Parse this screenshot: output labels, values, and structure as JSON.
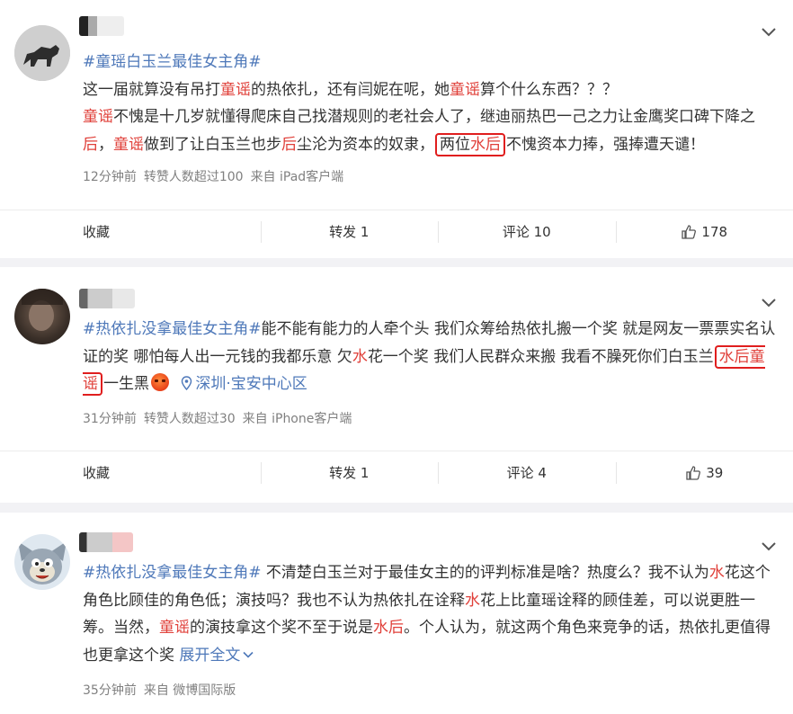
{
  "posts": [
    {
      "tag": "#童瑶白玉兰最佳女主角#",
      "text": {
        "l1a": "这一届就算没有吊打",
        "l1b": "童谣",
        "l1c": "的热依扎，还有闫妮在呢，她",
        "l1d": "童谣",
        "l1e": "算个什么东西？？？",
        "l2a": "童谣",
        "l2b": "不愧是十几岁就懂得爬床自己找潜规则的老社会人了，继迪丽热巴一己之力让金鹰奖口碑下降之",
        "l2c": "后",
        "l2d": "，",
        "l2e": "童谣",
        "l2f": "做到了让白玉兰也步",
        "l2g": "后",
        "l2h": "尘沦为资本的奴隶，",
        "box_a": "两位",
        "box_b": "水后",
        "l2i": "不愧资本力捧，强捧遭天谴！"
      },
      "meta": {
        "time": "12分钟前",
        "reposts": "转赞人数超过100",
        "source": "来自 iPad客户端"
      },
      "actions": {
        "collect": "收藏",
        "repost": "转发 1",
        "comment": "评论 10",
        "like": "178"
      }
    },
    {
      "tag": "#热依扎没拿最佳女主角#",
      "text": {
        "a": "能不能有能力的人牵个头 我们众筹给热依扎搬一个奖 就是网友一票票实名认证的奖 哪怕每人出一元钱的我都乐意 欠",
        "b": "水",
        "c": "花一个奖 我们人民群众来搬 我看不臊死你们白玉兰",
        "box": "水后童谣",
        "d": "一生黑",
        "loc": "深圳·宝安中心区"
      },
      "meta": {
        "time": "31分钟前",
        "reposts": "转赞人数超过30",
        "source": "来自 iPhone客户端"
      },
      "actions": {
        "collect": "收藏",
        "repost": "转发 1",
        "comment": "评论 4",
        "like": "39"
      }
    },
    {
      "tag": "#热依扎没拿最佳女主角#",
      "text": {
        "a": " 不清楚白玉兰对于最佳女主的的评判标准是啥？热度么？我不认为",
        "b": "水",
        "c": "花这个角色比顾佳的角色低；演技吗？我也不认为热依扎在诠释",
        "d": "水",
        "e": "花上比童瑶诠释的顾佳差，可以说更胜一筹。当然，",
        "f": "童谣",
        "g": "的演技拿这个奖不至于说是",
        "h": "水后",
        "i": "。个人认为，就这两个角色来竞争的话，热依扎更值得也更拿这个奖 ",
        "expand": "展开全文"
      },
      "meta": {
        "time": "35分钟前",
        "source": "来自 微博国际版"
      }
    }
  ],
  "colors": {
    "topic": "#4e78b9",
    "highlight": "#e0403a",
    "box": "#e01e1e",
    "meta": "#808080"
  }
}
